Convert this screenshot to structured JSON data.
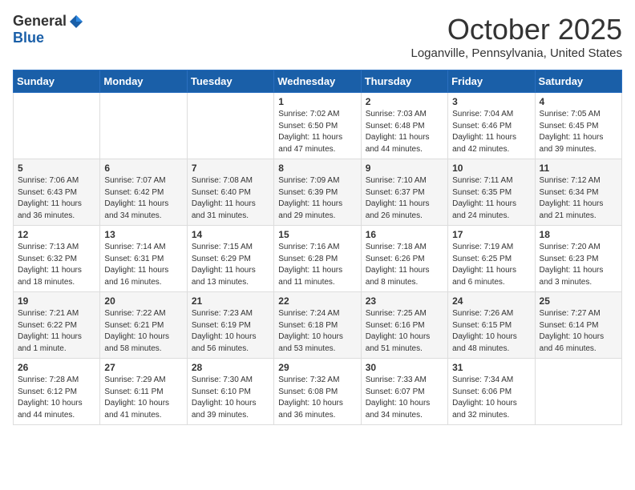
{
  "header": {
    "logo_general": "General",
    "logo_blue": "Blue",
    "month_title": "October 2025",
    "location": "Loganville, Pennsylvania, United States"
  },
  "weekdays": [
    "Sunday",
    "Monday",
    "Tuesday",
    "Wednesday",
    "Thursday",
    "Friday",
    "Saturday"
  ],
  "weeks": [
    [
      {
        "day": "",
        "info": ""
      },
      {
        "day": "",
        "info": ""
      },
      {
        "day": "",
        "info": ""
      },
      {
        "day": "1",
        "info": "Sunrise: 7:02 AM\nSunset: 6:50 PM\nDaylight: 11 hours\nand 47 minutes."
      },
      {
        "day": "2",
        "info": "Sunrise: 7:03 AM\nSunset: 6:48 PM\nDaylight: 11 hours\nand 44 minutes."
      },
      {
        "day": "3",
        "info": "Sunrise: 7:04 AM\nSunset: 6:46 PM\nDaylight: 11 hours\nand 42 minutes."
      },
      {
        "day": "4",
        "info": "Sunrise: 7:05 AM\nSunset: 6:45 PM\nDaylight: 11 hours\nand 39 minutes."
      }
    ],
    [
      {
        "day": "5",
        "info": "Sunrise: 7:06 AM\nSunset: 6:43 PM\nDaylight: 11 hours\nand 36 minutes."
      },
      {
        "day": "6",
        "info": "Sunrise: 7:07 AM\nSunset: 6:42 PM\nDaylight: 11 hours\nand 34 minutes."
      },
      {
        "day": "7",
        "info": "Sunrise: 7:08 AM\nSunset: 6:40 PM\nDaylight: 11 hours\nand 31 minutes."
      },
      {
        "day": "8",
        "info": "Sunrise: 7:09 AM\nSunset: 6:39 PM\nDaylight: 11 hours\nand 29 minutes."
      },
      {
        "day": "9",
        "info": "Sunrise: 7:10 AM\nSunset: 6:37 PM\nDaylight: 11 hours\nand 26 minutes."
      },
      {
        "day": "10",
        "info": "Sunrise: 7:11 AM\nSunset: 6:35 PM\nDaylight: 11 hours\nand 24 minutes."
      },
      {
        "day": "11",
        "info": "Sunrise: 7:12 AM\nSunset: 6:34 PM\nDaylight: 11 hours\nand 21 minutes."
      }
    ],
    [
      {
        "day": "12",
        "info": "Sunrise: 7:13 AM\nSunset: 6:32 PM\nDaylight: 11 hours\nand 18 minutes."
      },
      {
        "day": "13",
        "info": "Sunrise: 7:14 AM\nSunset: 6:31 PM\nDaylight: 11 hours\nand 16 minutes."
      },
      {
        "day": "14",
        "info": "Sunrise: 7:15 AM\nSunset: 6:29 PM\nDaylight: 11 hours\nand 13 minutes."
      },
      {
        "day": "15",
        "info": "Sunrise: 7:16 AM\nSunset: 6:28 PM\nDaylight: 11 hours\nand 11 minutes."
      },
      {
        "day": "16",
        "info": "Sunrise: 7:18 AM\nSunset: 6:26 PM\nDaylight: 11 hours\nand 8 minutes."
      },
      {
        "day": "17",
        "info": "Sunrise: 7:19 AM\nSunset: 6:25 PM\nDaylight: 11 hours\nand 6 minutes."
      },
      {
        "day": "18",
        "info": "Sunrise: 7:20 AM\nSunset: 6:23 PM\nDaylight: 11 hours\nand 3 minutes."
      }
    ],
    [
      {
        "day": "19",
        "info": "Sunrise: 7:21 AM\nSunset: 6:22 PM\nDaylight: 11 hours\nand 1 minute."
      },
      {
        "day": "20",
        "info": "Sunrise: 7:22 AM\nSunset: 6:21 PM\nDaylight: 10 hours\nand 58 minutes."
      },
      {
        "day": "21",
        "info": "Sunrise: 7:23 AM\nSunset: 6:19 PM\nDaylight: 10 hours\nand 56 minutes."
      },
      {
        "day": "22",
        "info": "Sunrise: 7:24 AM\nSunset: 6:18 PM\nDaylight: 10 hours\nand 53 minutes."
      },
      {
        "day": "23",
        "info": "Sunrise: 7:25 AM\nSunset: 6:16 PM\nDaylight: 10 hours\nand 51 minutes."
      },
      {
        "day": "24",
        "info": "Sunrise: 7:26 AM\nSunset: 6:15 PM\nDaylight: 10 hours\nand 48 minutes."
      },
      {
        "day": "25",
        "info": "Sunrise: 7:27 AM\nSunset: 6:14 PM\nDaylight: 10 hours\nand 46 minutes."
      }
    ],
    [
      {
        "day": "26",
        "info": "Sunrise: 7:28 AM\nSunset: 6:12 PM\nDaylight: 10 hours\nand 44 minutes."
      },
      {
        "day": "27",
        "info": "Sunrise: 7:29 AM\nSunset: 6:11 PM\nDaylight: 10 hours\nand 41 minutes."
      },
      {
        "day": "28",
        "info": "Sunrise: 7:30 AM\nSunset: 6:10 PM\nDaylight: 10 hours\nand 39 minutes."
      },
      {
        "day": "29",
        "info": "Sunrise: 7:32 AM\nSunset: 6:08 PM\nDaylight: 10 hours\nand 36 minutes."
      },
      {
        "day": "30",
        "info": "Sunrise: 7:33 AM\nSunset: 6:07 PM\nDaylight: 10 hours\nand 34 minutes."
      },
      {
        "day": "31",
        "info": "Sunrise: 7:34 AM\nSunset: 6:06 PM\nDaylight: 10 hours\nand 32 minutes."
      },
      {
        "day": "",
        "info": ""
      }
    ]
  ]
}
